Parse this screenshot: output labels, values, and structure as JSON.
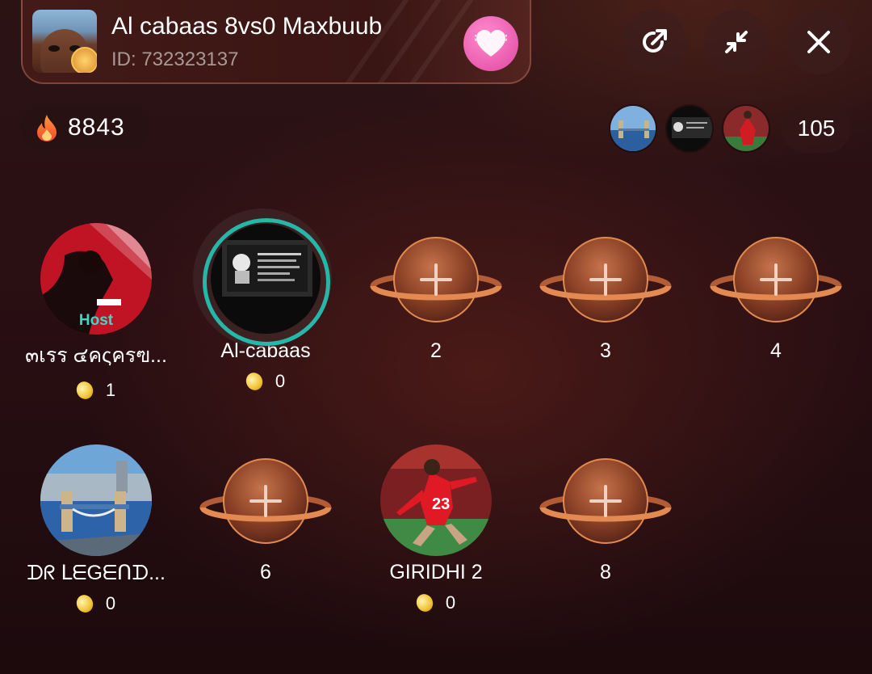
{
  "room": {
    "title": "Al cabaas 8vs0 Maxbuub",
    "id_text": "ID: 732323137"
  },
  "header_buttons": [
    "share-icon",
    "minimize-icon",
    "close-icon"
  ],
  "popularity": {
    "value": "8843",
    "icon": "fire-icon"
  },
  "viewers": {
    "count": "105"
  },
  "seats": [
    {
      "name": "๓เรร ๔คςครฃ...",
      "coins": "1",
      "host_label": "Host",
      "type": "host"
    },
    {
      "name": "Al-cabaas",
      "coins": "0",
      "type": "user"
    },
    {
      "name": "2",
      "type": "empty"
    },
    {
      "name": "3",
      "type": "empty"
    },
    {
      "name": "4",
      "type": "empty"
    },
    {
      "name": "ᗪᖇ ᒪᗴGᗴᑎᗪ...",
      "coins": "0",
      "type": "user"
    },
    {
      "name": "6",
      "type": "empty"
    },
    {
      "name": "GIRIDHI 2",
      "coins": "0",
      "type": "user"
    },
    {
      "name": "8",
      "type": "empty"
    }
  ],
  "colors": {
    "host_teal": "#42d6c0",
    "ring_teal": "#25b7a7",
    "like_pink": "#e0469f",
    "coin_gold": "#f2c232"
  }
}
